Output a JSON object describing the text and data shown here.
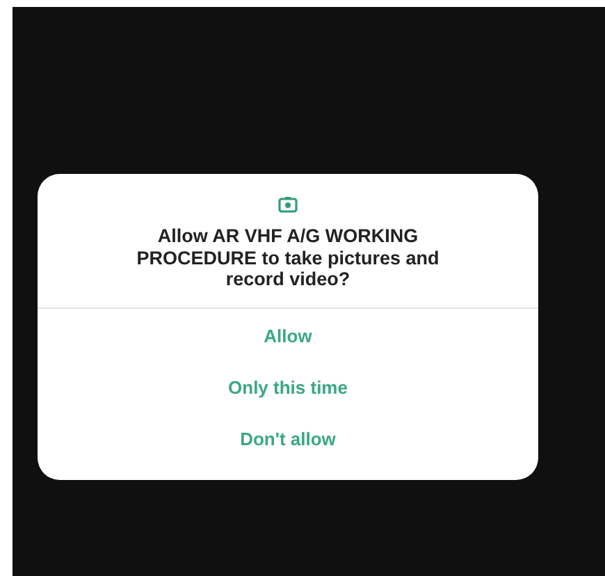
{
  "dialog": {
    "message": "Allow AR VHF A/G WORKING PROCEDURE to take pictures and record video?",
    "buttons": [
      {
        "label": "Allow"
      },
      {
        "label": "Only this time"
      },
      {
        "label": "Don't allow"
      }
    ]
  }
}
